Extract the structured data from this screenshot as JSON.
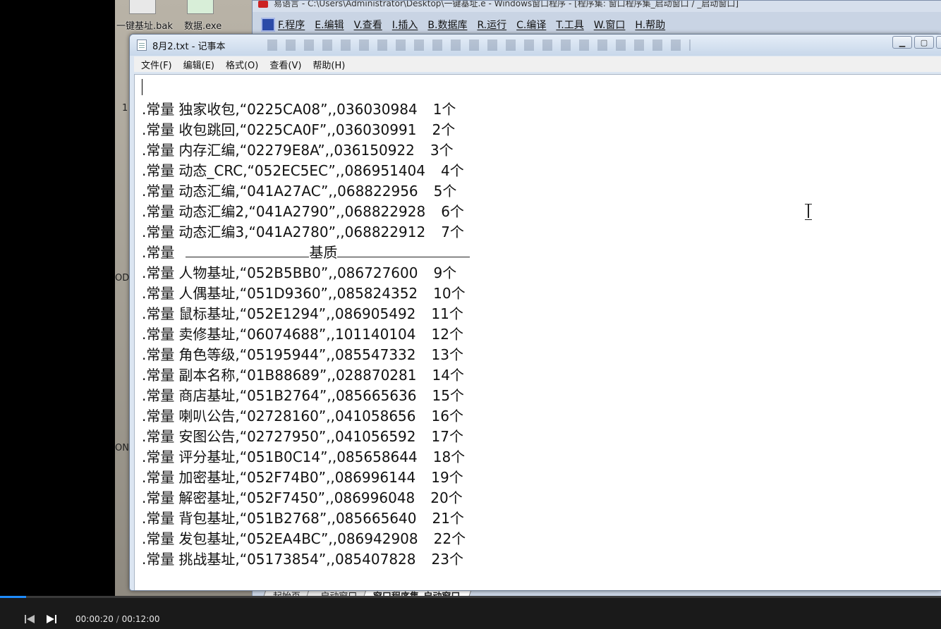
{
  "desktop": {
    "icons": [
      {
        "label": "一键基址.bak"
      },
      {
        "label": "数据.exe"
      }
    ],
    "side_glyphs": [
      "1",
      "OD",
      "ON"
    ]
  },
  "ide": {
    "title": "易语言 - C:\\Users\\Administrator\\Desktop\\一键基址.e - Windows窗口程序 - [程序集: 窗口程序集_启动窗口 / _启动窗口]",
    "menu": [
      "F.程序",
      "E.编辑",
      "V.查看",
      "I.插入",
      "B.数据库",
      "R.运行",
      "C.编译",
      "T.工具",
      "W.窗口",
      "H.帮助"
    ],
    "tabs": [
      "起始页",
      "_启动窗口",
      "窗口程序集_启动窗口"
    ]
  },
  "notepad": {
    "title": "8月2.txt - 记事本",
    "menu": [
      "文件(F)",
      "编辑(E)",
      "格式(O)",
      "查看(V)",
      "帮助(H)"
    ],
    "lines": [
      {
        "kw": ".常量",
        "name": "独家收包,",
        "hex": "“0225CA08”",
        "num": ",,036030984",
        "cnt": "1个"
      },
      {
        "kw": ".常量",
        "name": "收包跳回,",
        "hex": "“0225CA0F”",
        "num": ",,036030991",
        "cnt": "2个"
      },
      {
        "kw": ".常量",
        "name": "内存汇编,",
        "hex": "“02279E8A”",
        "num": ",,036150922",
        "cnt": "3个"
      },
      {
        "kw": ".常量",
        "name": "动态_CRC,",
        "hex": "“052EC5EC”",
        "num": ",,086951404",
        "cnt": "4个"
      },
      {
        "kw": ".常量",
        "name": "动态汇编,",
        "hex": "“041A27AC”",
        "num": ",,068822956",
        "cnt": "5个"
      },
      {
        "kw": ".常量",
        "name": "动态汇编2,",
        "hex": "“041A2790”",
        "num": ",,068822928",
        "cnt": "6个"
      },
      {
        "kw": ".常量",
        "name": "动态汇编3,",
        "hex": "“041A2780”",
        "num": ",,068822912",
        "cnt": "7个"
      },
      {
        "kw": ".常量",
        "section": "基质"
      },
      {
        "kw": ".常量",
        "name": "人物基址,",
        "hex": "“052B5BB0”",
        "num": ",,086727600",
        "cnt": "9个"
      },
      {
        "kw": ".常量",
        "name": "人偶基址,",
        "hex": "“051D9360”",
        "num": ",,085824352",
        "cnt": "10个"
      },
      {
        "kw": ".常量",
        "name": "鼠标基址,",
        "hex": "“052E1294”",
        "num": ",,086905492",
        "cnt": "11个"
      },
      {
        "kw": ".常量",
        "name": "卖修基址,",
        "hex": "“06074688”",
        "num": ",,101140104",
        "cnt": "12个"
      },
      {
        "kw": ".常量",
        "name": "角色等级,",
        "hex": "“05195944”",
        "num": ",,085547332",
        "cnt": "13个"
      },
      {
        "kw": ".常量",
        "name": "副本名称,",
        "hex": "“01B88689”",
        "num": ",,028870281",
        "cnt": "14个"
      },
      {
        "kw": ".常量",
        "name": "商店基址,",
        "hex": "“051B2764”",
        "num": ",,085665636",
        "cnt": "15个"
      },
      {
        "kw": ".常量",
        "name": "喇叭公告,",
        "hex": "“02728160”",
        "num": ",,041058656",
        "cnt": "16个"
      },
      {
        "kw": ".常量",
        "name": "安图公告,",
        "hex": "“02727950”",
        "num": ",,041056592",
        "cnt": "17个"
      },
      {
        "kw": ".常量",
        "name": "评分基址,",
        "hex": "“051B0C14”",
        "num": ",,085658644",
        "cnt": "18个"
      },
      {
        "kw": ".常量",
        "name": "加密基址,",
        "hex": "“052F74B0”",
        "num": ",,086996144",
        "cnt": "19个"
      },
      {
        "kw": ".常量",
        "name": "解密基址,",
        "hex": "“052F7450”",
        "num": ",,086996048",
        "cnt": "20个"
      },
      {
        "kw": ".常量",
        "name": "背包基址,",
        "hex": "“051B2768”",
        "num": ",,085665640",
        "cnt": "21个"
      },
      {
        "kw": ".常量",
        "name": "发包基址,",
        "hex": "“052EA4BC”",
        "num": ",,086942908",
        "cnt": "22个"
      },
      {
        "kw": ".常量",
        "name": "挑战基址,",
        "hex": "“05173854”",
        "num": ",,085407828",
        "cnt": "23个"
      }
    ]
  },
  "player": {
    "current_time": "00:00:20",
    "separator": "/",
    "total_time": "00:12:00",
    "progress_fraction": 0.028,
    "accent_color": "#1e8cff"
  }
}
